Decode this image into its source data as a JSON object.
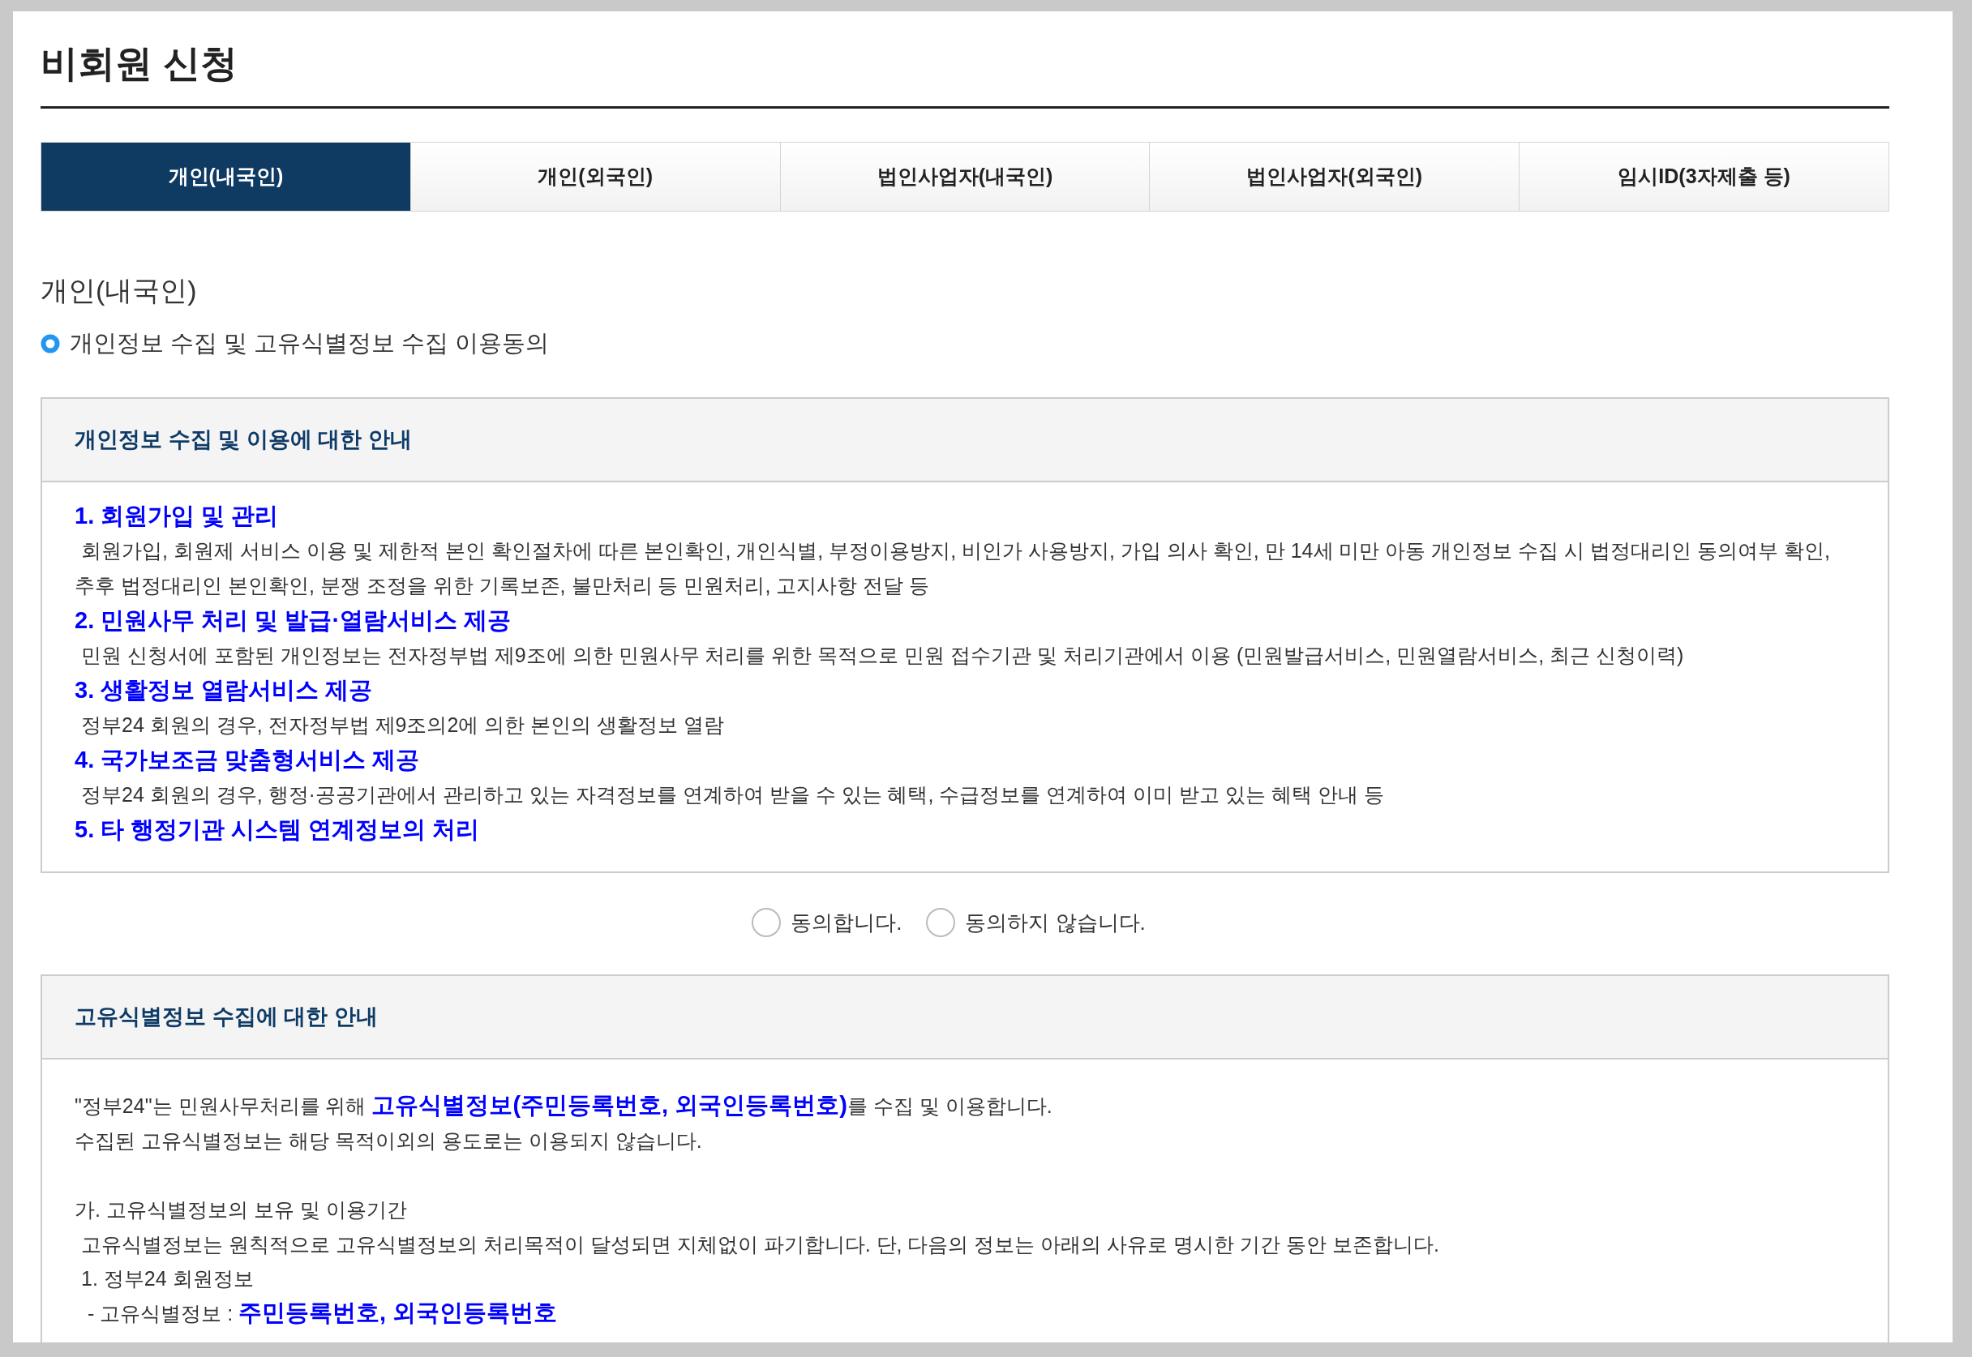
{
  "page": {
    "title": "비회원 신청"
  },
  "tabs": [
    {
      "label": "개인(내국인)",
      "selected": true
    },
    {
      "label": "개인(외국인)",
      "selected": false
    },
    {
      "label": "법인사업자(내국인)",
      "selected": false
    },
    {
      "label": "법인사업자(외국인)",
      "selected": false
    },
    {
      "label": "임시ID(3자제출 등)",
      "selected": false
    }
  ],
  "section_title": "개인(내국인)",
  "consent_heading": "개인정보 수집 및 고유식별정보 수집 이용동의",
  "privacy_notice": {
    "header": "개인정보 수집 및 이용에 대한 안내",
    "lines": [
      {
        "kind": "heading",
        "text": "1. 회원가입 및 관리"
      },
      {
        "kind": "body",
        "text": "회원가입, 회원제 서비스 이용 및 제한적 본인 확인절차에 따른 본인확인, 개인식별, 부정이용방지, 비인가 사용방지, 가입 의사 확인, 만 14세 미만 아동 개인정보 수집 시 법정대리인 동의여부 확인, 추후 법정대리인 본인확인, 분쟁 조정을 위한 기록보존, 불만처리 등 민원처리, 고지사항 전달 등"
      },
      {
        "kind": "heading",
        "text": "2. 민원사무 처리 및 발급·열람서비스 제공"
      },
      {
        "kind": "body",
        "text": "민원 신청서에 포함된 개인정보는 전자정부법 제9조에 의한 민원사무 처리를 위한 목적으로 민원 접수기관 및 처리기관에서 이용 (민원발급서비스, 민원열람서비스, 최근 신청이력)"
      },
      {
        "kind": "heading",
        "text": "3. 생활정보 열람서비스 제공"
      },
      {
        "kind": "body",
        "text": "정부24 회원의 경우, 전자정부법 제9조의2에 의한 본인의 생활정보 열람"
      },
      {
        "kind": "heading",
        "text": "4. 국가보조금 맞춤형서비스 제공"
      },
      {
        "kind": "body",
        "text": "정부24 회원의 경우, 행정·공공기관에서 관리하고 있는 자격정보를 연계하여 받을 수 있는 혜택, 수급정보를 연계하여 이미 받고 있는 혜택 안내 등"
      },
      {
        "kind": "heading",
        "text": "5. 타 행정기관 시스템 연계정보의 처리"
      }
    ]
  },
  "agree_options": [
    {
      "label": "동의합니다.",
      "selected": false
    },
    {
      "label": "동의하지 않습니다.",
      "selected": false
    }
  ],
  "unique_id_notice": {
    "header": "고유식별정보 수집에 대한 안내",
    "blocks": [
      {
        "lines": [
          {
            "kind": "plain",
            "text": "\"정부24\"는 민원사무처리를 위해 **고유식별정보(주민등록번호, 외국인등록번호)**를 수집 및 이용합니다."
          },
          {
            "kind": "plain",
            "text": "수집된 고유식별정보는 해당 목적이외의 용도로는 이용되지 않습니다."
          }
        ]
      },
      {
        "lines": [
          {
            "kind": "plain",
            "text": "가. 고유식별정보의 보유 및 이용기간"
          },
          {
            "kind": "indent1",
            "text": "고유식별정보는 원칙적으로 고유식별정보의 처리목적이 달성되면 지체없이 파기합니다. 단, 다음의 정보는 아래의 사유로 명시한 기간 동안 보존합니다."
          },
          {
            "kind": "indent1",
            "text": "1. 정부24 회원정보"
          },
          {
            "kind": "indent2",
            "text": "- 고유식별정보 : **주민등록번호, 외국인등록번호**"
          }
        ]
      }
    ]
  }
}
